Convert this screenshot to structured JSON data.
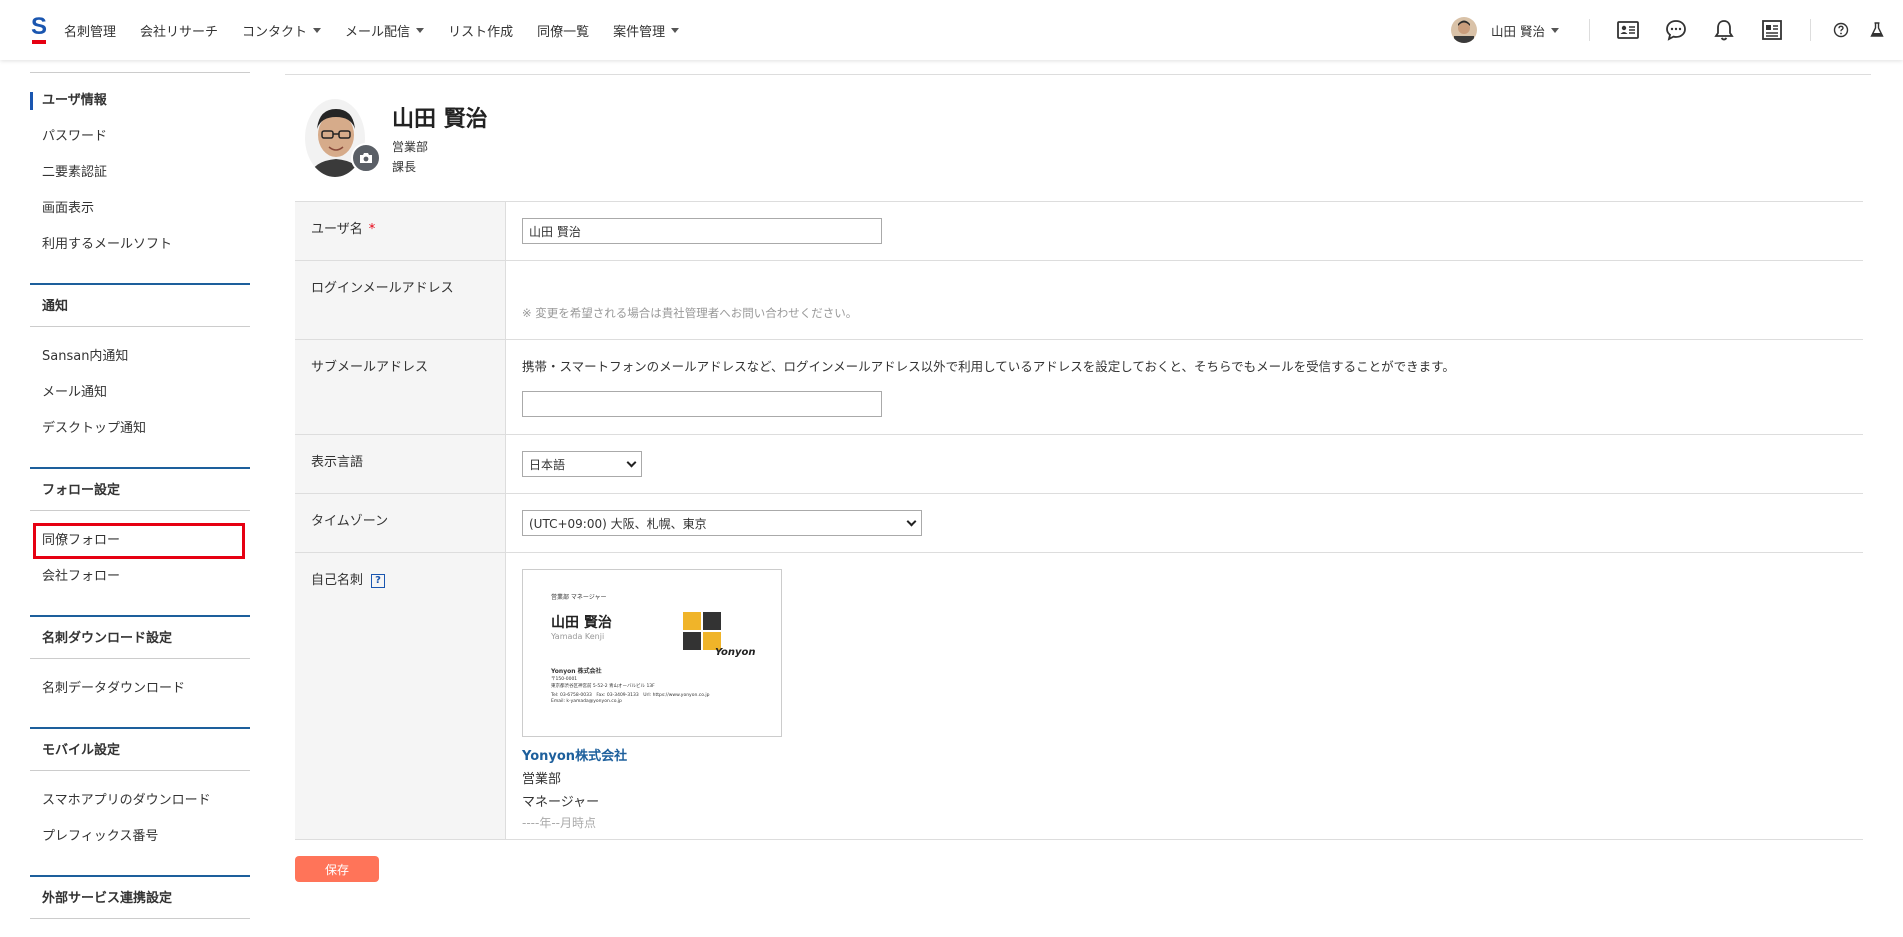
{
  "header": {
    "logo_letter": "S",
    "nav": [
      {
        "label": "名刺管理",
        "dropdown": false
      },
      {
        "label": "会社リサーチ",
        "dropdown": false
      },
      {
        "label": "コンタクト",
        "dropdown": true
      },
      {
        "label": "メール配信",
        "dropdown": true
      },
      {
        "label": "リスト作成",
        "dropdown": false
      },
      {
        "label": "同僚一覧",
        "dropdown": false
      },
      {
        "label": "案件管理",
        "dropdown": true
      }
    ],
    "user_name": "山田 賢治",
    "icons": [
      "business-card-icon",
      "chat-icon",
      "bell-icon",
      "news-icon",
      "help-icon",
      "lab-icon"
    ]
  },
  "sidebar": {
    "items_top": [
      "ユーザ情報",
      "パスワード",
      "二要素認証",
      "画面表示",
      "利用するメールソフト"
    ],
    "groups": [
      {
        "title": "通知",
        "items": [
          "Sansan内通知",
          "メール通知",
          "デスクトップ通知"
        ]
      },
      {
        "title": "フォロー設定",
        "items": [
          "同僚フォロー",
          "会社フォロー"
        ]
      },
      {
        "title": "名刺ダウンロード設定",
        "items": [
          "名刺データダウンロード"
        ]
      },
      {
        "title": "モバイル設定",
        "items": [
          "スマホアプリのダウンロード",
          "プレフィックス番号"
        ]
      },
      {
        "title": "外部サービス連携設定",
        "items": []
      }
    ]
  },
  "profile": {
    "name": "山田 賢治",
    "department": "営業部",
    "title": "課長"
  },
  "form": {
    "username_label": "ユーザ名",
    "required_mark": "*",
    "username_value": "山田 賢治",
    "login_email_label": "ログインメールアドレス",
    "login_email_hint": "※ 変更を希望される場合は貴社管理者へお問い合わせください。",
    "sub_email_label": "サブメールアドレス",
    "sub_email_desc": "携帯・スマートフォンのメールアドレスなど、ログインメールアドレス以外で利用しているアドレスを設定しておくと、そちらでもメールを受信することができます。",
    "sub_email_value": "",
    "language_label": "表示言語",
    "language_value": "日本語",
    "timezone_label": "タイムゾーン",
    "timezone_value": "(UTC+09:00) 大阪、札幌、東京",
    "own_card_label": "自己名刺",
    "help_mark": "?",
    "card": {
      "dept_title": "営業部 マネージャー",
      "name": "山田 賢治",
      "roman": "Yamada Kenji",
      "company": "Yonyon 株式会社",
      "postal": "〒150-0001",
      "address": "東京都渋谷区神宮前 5-52-2 青山オーバルビル 13F",
      "contact": "Tel: 03-6758-0033　Fax: 03-3409-3133　Url: https://www.yonyon.co.jp",
      "email": "Email: k-yamada@yonyon.co.jp",
      "brand": "Yonyon",
      "square_colors": [
        "#f0b429",
        "#333333",
        "#333333",
        "#f0b429"
      ]
    },
    "card_company": "Yonyon株式会社",
    "card_department": "営業部",
    "card_title": "マネージャー",
    "card_date": "----年--月時点"
  },
  "save_label": "保存",
  "colors": {
    "brand_blue": "#1a56b0",
    "accent_red": "#e60012",
    "save_button": "#ff7459",
    "link_blue": "#1d5f9c"
  }
}
